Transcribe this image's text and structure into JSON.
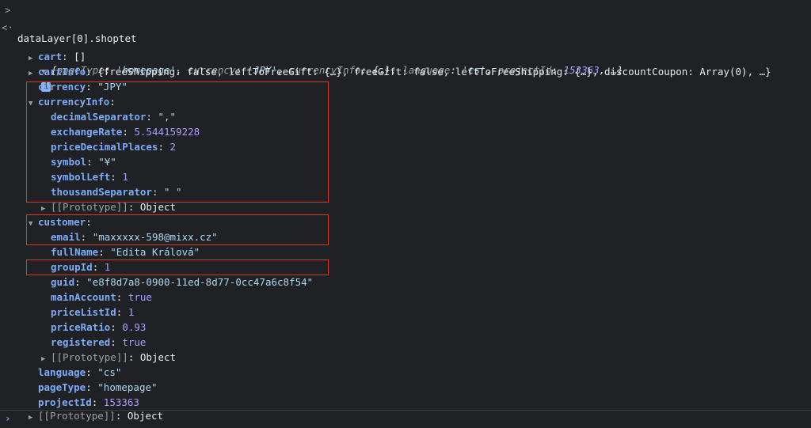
{
  "console": {
    "input_command": "dataLayer[0].shoptet",
    "summary": {
      "pageType_key": "pageType",
      "pageType_val": "'homepage'",
      "currency_key": "currency",
      "currency_val": "'JPY'",
      "currencyInfo_key": "currencyInfo",
      "currencyInfo_val": "{…}",
      "language_key": "language",
      "language_val": "'cs'",
      "projectId_key": "projectId",
      "projectId_val": "153363",
      "ellipsis": "…}"
    },
    "info_badge": "i",
    "rows": {
      "cart": {
        "key": "cart",
        "val": "[]"
      },
      "cartInfo": {
        "key": "cartInfo",
        "val": "{freeShipping: false, leftToFreeGift: {…}, freeGift: false, leftToFreeShipping: {…}, discountCoupon: Array(0), …}"
      },
      "currency": {
        "key": "currency",
        "val": "\"JPY\""
      },
      "currencyInfo": {
        "key": "currencyInfo"
      },
      "decimalSeparator": {
        "key": "decimalSeparator",
        "val": "\",\""
      },
      "exchangeRate": {
        "key": "exchangeRate",
        "val": "5.544159228"
      },
      "priceDecimalPlaces": {
        "key": "priceDecimalPlaces",
        "val": "2"
      },
      "symbol": {
        "key": "symbol",
        "val": "\"¥\""
      },
      "symbolLeft": {
        "key": "symbolLeft",
        "val": "1"
      },
      "thousandSeparator": {
        "key": "thousandSeparator",
        "val": "\" \""
      },
      "proto1": {
        "key": "[[Prototype]]",
        "val": "Object"
      },
      "customer": {
        "key": "customer"
      },
      "email": {
        "key": "email",
        "val": "\"maxxxxx-598@mixx.cz\""
      },
      "fullName": {
        "key": "fullName",
        "val": "\"Edita Králová\""
      },
      "groupId": {
        "key": "groupId",
        "val": "1"
      },
      "guid": {
        "key": "guid",
        "val": "\"e8f8d7a8-0900-11ed-8d77-0cc47a6c8f54\""
      },
      "mainAccount": {
        "key": "mainAccount",
        "val": "true"
      },
      "priceListId": {
        "key": "priceListId",
        "val": "1"
      },
      "priceRatio": {
        "key": "priceRatio",
        "val": "0.93"
      },
      "registered": {
        "key": "registered",
        "val": "true"
      },
      "proto2": {
        "key": "[[Prototype]]",
        "val": "Object"
      },
      "language": {
        "key": "language",
        "val": "\"cs\""
      },
      "pageType": {
        "key": "pageType",
        "val": "\"homepage\""
      },
      "projectId": {
        "key": "projectId",
        "val": "153363"
      },
      "proto3": {
        "key": "[[Prototype]]",
        "val": "Object"
      }
    },
    "prompt_symbol": "›",
    "input_prompt_symbol": ">",
    "return_symbol": "<·"
  }
}
